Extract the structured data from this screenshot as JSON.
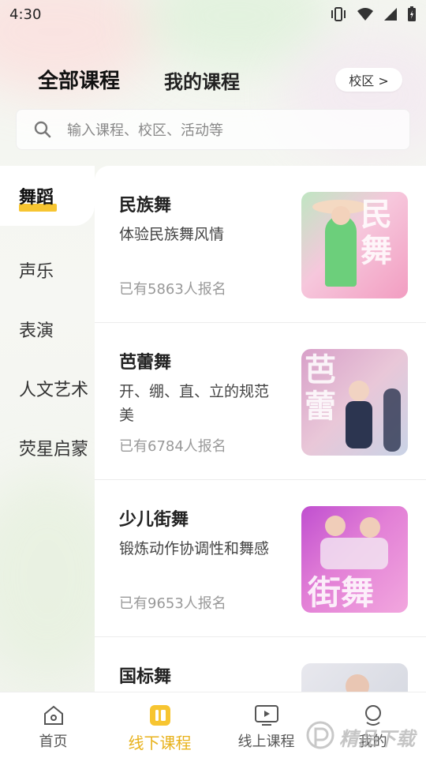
{
  "status_bar": {
    "time": "4:30"
  },
  "top_tabs": {
    "all_courses": "全部课程",
    "my_courses": "我的课程",
    "campus_button": "校区 >"
  },
  "search": {
    "placeholder": "输入课程、校区、活动等"
  },
  "sidebar": {
    "items": [
      {
        "label": "舞蹈",
        "active": true
      },
      {
        "label": "声乐",
        "active": false
      },
      {
        "label": "表演",
        "active": false
      },
      {
        "label": "人文艺术",
        "active": false
      },
      {
        "label": "荧星启蒙",
        "active": false
      }
    ]
  },
  "courses": [
    {
      "title": "民族舞",
      "desc": "体验民族舞风情",
      "count": "已有5863人报名",
      "thumb_text": "民舞"
    },
    {
      "title": "芭蕾舞",
      "desc": "开、绷、直、立的规范美",
      "count": "已有6784人报名",
      "thumb_text": "芭蕾"
    },
    {
      "title": "少儿街舞",
      "desc": "锻炼动作协调性和舞感",
      "count": "已有9653人报名",
      "thumb_text": "街舞"
    },
    {
      "title": "国标舞",
      "desc": "",
      "count": "",
      "thumb_text": ""
    }
  ],
  "bottom_nav": {
    "items": [
      {
        "label": "首页",
        "icon": "home-icon",
        "active": false
      },
      {
        "label": "线下课程",
        "icon": "offline-course-icon",
        "active": true
      },
      {
        "label": "线上课程",
        "icon": "online-course-icon",
        "active": false
      },
      {
        "label": "我的",
        "icon": "profile-icon",
        "active": false
      }
    ]
  },
  "watermark": {
    "text": "精品下载"
  },
  "colors": {
    "accent": "#f7c531",
    "active_label": "#e8b21c"
  }
}
